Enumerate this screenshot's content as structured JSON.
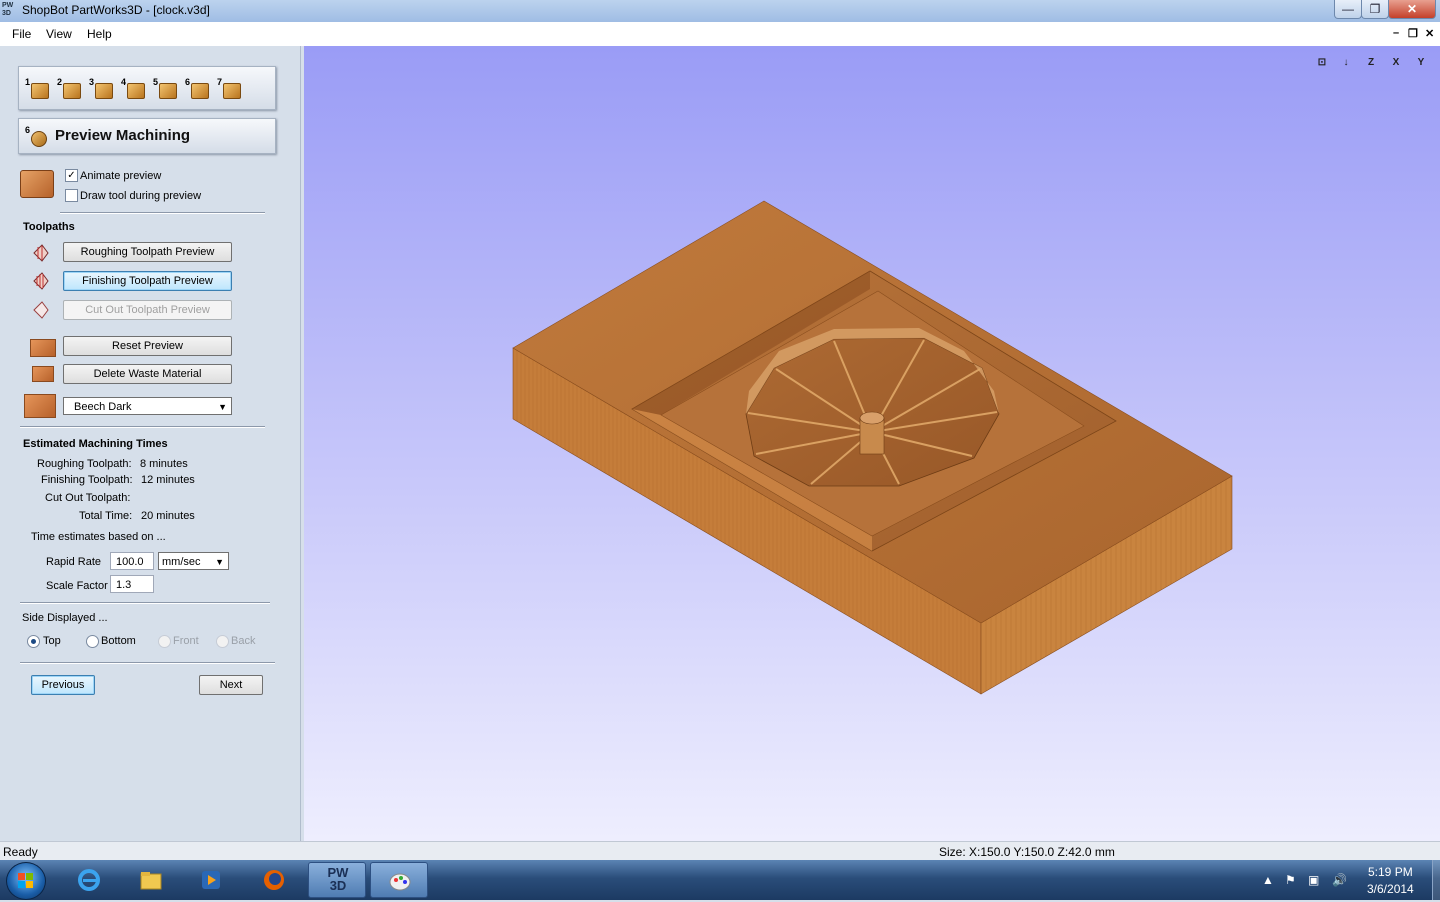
{
  "window": {
    "app_icon_text": "PW\n3D",
    "title": "ShopBot PartWorks3D - [clock.v3d]",
    "controls": {
      "minimize": "—",
      "maximize": "❐",
      "close": "✕"
    }
  },
  "menu": {
    "items": [
      "File",
      "View",
      "Help"
    ],
    "mdi_controls": {
      "minimize": "–",
      "restore": "❐",
      "close": "✕"
    }
  },
  "steps": {
    "numbers": [
      "1",
      "2",
      "3",
      "4",
      "5",
      "6",
      "7"
    ]
  },
  "panel_title": {
    "step": "6",
    "label": "Preview Machining"
  },
  "preview_options": {
    "animate": {
      "label": "Animate preview",
      "checked": true
    },
    "draw_tool": {
      "label": "Draw tool during preview",
      "checked": false
    }
  },
  "toolpaths": {
    "heading": "Toolpaths",
    "roughing": "Roughing Toolpath Preview",
    "finishing": "Finishing Toolpath Preview",
    "cutout": "Cut Out Toolpath Preview",
    "reset": "Reset Preview",
    "delete_waste": "Delete Waste Material",
    "material": "Beech Dark"
  },
  "times": {
    "heading": "Estimated Machining Times",
    "roughing_label": "Roughing Toolpath:",
    "roughing_value": "8 minutes",
    "finishing_label": "Finishing Toolpath:",
    "finishing_value": "12 minutes",
    "cutout_label": "Cut Out Toolpath:",
    "cutout_value": "",
    "total_label": "Total Time:",
    "total_value": "20 minutes",
    "based_on": "Time estimates based on ...",
    "rapid_label": "Rapid Rate",
    "rapid_value": "100.0",
    "rapid_unit": "mm/sec",
    "scale_label": "Scale Factor",
    "scale_value": "1.3"
  },
  "side": {
    "heading": "Side Displayed ...",
    "options": [
      {
        "label": "Top",
        "selected": true,
        "enabled": true
      },
      {
        "label": "Bottom",
        "selected": false,
        "enabled": true
      },
      {
        "label": "Front",
        "selected": false,
        "enabled": false
      },
      {
        "label": "Back",
        "selected": false,
        "enabled": false
      }
    ]
  },
  "nav": {
    "previous": "Previous",
    "next": "Next"
  },
  "view_controls": [
    "fit-view-icon",
    "iso-view-icon",
    "z-view-icon",
    "x-view-icon",
    "y-view-icon"
  ],
  "view_control_labels": [
    "⊡",
    "↓",
    "Z",
    "X",
    "Y"
  ],
  "status": {
    "ready": "Ready",
    "size": "Size: X:150.0 Y:150.0 Z:42.0 mm"
  },
  "taskbar": {
    "time": "5:19 PM",
    "date": "3/6/2014",
    "apps": [
      "internet-explorer-icon",
      "file-explorer-icon",
      "media-player-icon",
      "firefox-icon",
      "partworks3d-icon",
      "paint-icon"
    ],
    "pw3d_label": "PW\n3D"
  },
  "colors": {
    "wood_top": "#b66f35",
    "wood_left": "#c27a38",
    "wood_right": "#c8803a",
    "viewport_top": "#9a9cf6",
    "viewport_bottom": "#eeeefe"
  }
}
